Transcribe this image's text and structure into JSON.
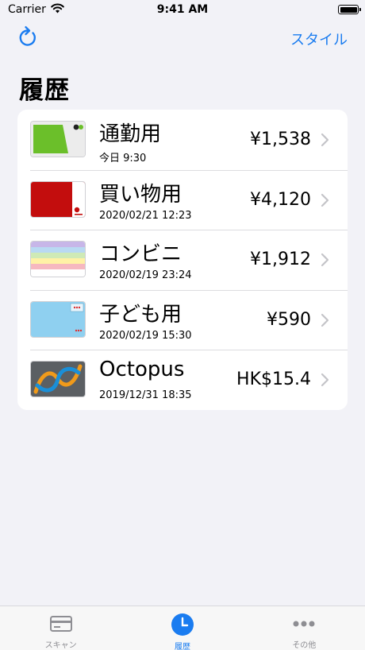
{
  "status_bar": {
    "carrier": "Carrier",
    "time": "9:41 AM"
  },
  "nav": {
    "refresh_icon": "refresh-icon",
    "style_label": "スタイル"
  },
  "page": {
    "title": "履歴"
  },
  "cards": [
    {
      "name": "通勤用",
      "date": "今日 9:30",
      "amount": "¥1,538",
      "thumb": "green-card"
    },
    {
      "name": "買い物用",
      "date": "2020/02/21 12:23",
      "amount": "¥4,120",
      "thumb": "red-card"
    },
    {
      "name": "コンビニ",
      "date": "2020/02/19 23:24",
      "amount": "¥1,912",
      "thumb": "pastel-stripe-card"
    },
    {
      "name": "子ども用",
      "date": "2020/02/19 15:30",
      "amount": "¥590",
      "thumb": "light-blue-card"
    },
    {
      "name": "Octopus",
      "date": "2019/12/31 18:35",
      "amount": "HK$15.4",
      "thumb": "octopus-card"
    }
  ],
  "tabs": [
    {
      "label": "スキャン",
      "icon": "card-icon",
      "active": false
    },
    {
      "label": "履歴",
      "icon": "clock-icon",
      "active": true
    },
    {
      "label": "その他",
      "icon": "more-icon",
      "active": false
    }
  ],
  "colors": {
    "accent": "#1a7cf0",
    "background": "#f2f2f7",
    "inactive": "#8e8e93"
  }
}
